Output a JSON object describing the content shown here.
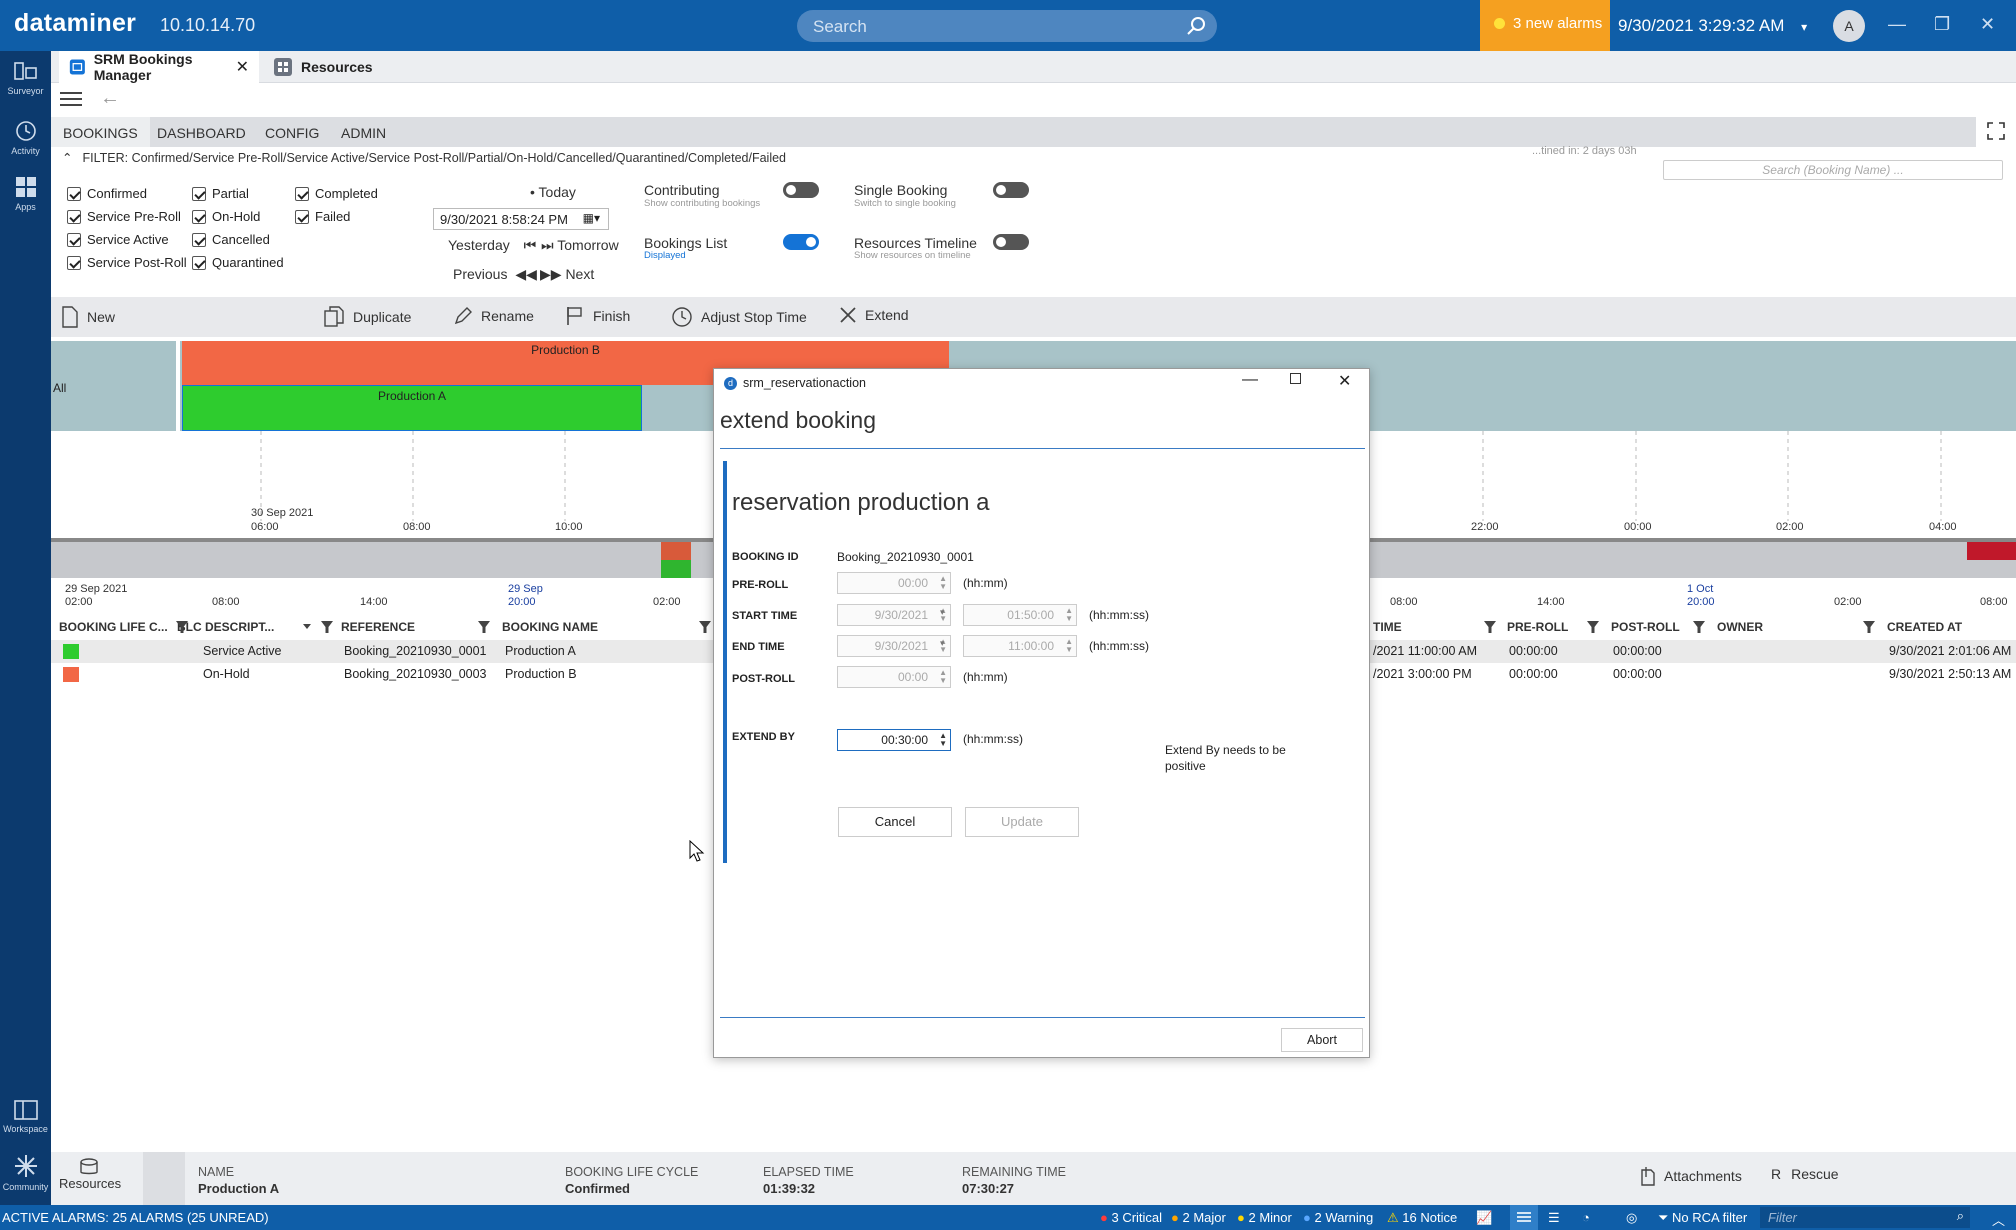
{
  "app": {
    "brand": "dataminer",
    "version": "10.10.14.70",
    "search_placeholder": "Search",
    "alarms": "3 new alarms",
    "datetime": "9/30/2021 3:29:32 AM",
    "user_initial": "A"
  },
  "sidebar": [
    {
      "label": "Surveyor",
      "icon": "surveyor-icon"
    },
    {
      "label": "Activity",
      "icon": "history-icon"
    },
    {
      "label": "Apps",
      "icon": "apps-icon"
    },
    {
      "label": "Workspace",
      "icon": "workspace-icon"
    },
    {
      "label": "Community",
      "icon": "community-icon"
    }
  ],
  "tabs": [
    {
      "label": "SRM Bookings Manager"
    },
    {
      "label": "Resources"
    }
  ],
  "nav": [
    "BOOKINGS",
    "DASHBOARD",
    "CONFIG",
    "ADMIN"
  ],
  "filter": {
    "text": "FILTER: Confirmed/Service Pre-Roll/Service Active/Service Post-Roll/Partial/On-Hold/Cancelled/Quarantined/Completed/Failed",
    "runs": "...tined in: 2 days 03h",
    "search_placeholder": "Search (Booking Name) ...",
    "checks": [
      "Confirmed",
      "Service Pre-Roll",
      "Service Active",
      "Service Post-Roll",
      "Partial",
      "On-Hold",
      "Cancelled",
      "Quarantined",
      "Completed",
      "Failed"
    ]
  },
  "datenav": {
    "today": "Today",
    "date": "9/30/2021 8:58:24 PM",
    "yesterday": "Yesterday",
    "tomorrow": "Tomorrow",
    "previous": "Previous",
    "next": "Next"
  },
  "toggles": [
    {
      "label": "Contributing",
      "sub": "Show contributing bookings",
      "on": false
    },
    {
      "label": "Single Booking",
      "sub": "Switch to single booking",
      "on": false
    },
    {
      "label": "Bookings List",
      "sub": "Displayed",
      "on": true
    },
    {
      "label": "Resources Timeline",
      "sub": "Show resources on timeline",
      "on": false
    }
  ],
  "toolbar": [
    "New",
    "Duplicate",
    "Rename",
    "Finish",
    "Adjust Stop Time",
    "Extend"
  ],
  "timeline": {
    "all": "All",
    "prodB": "Production B",
    "prodA": "Production A",
    "ticks": [
      {
        "date": "30 Sep 2021",
        "time": "06:00"
      },
      {
        "time": "08:00"
      },
      {
        "time": "10:00"
      },
      {
        "time": "22:00"
      },
      {
        "time": "00:00"
      },
      {
        "time": "02:00"
      },
      {
        "time": "04:00"
      }
    ],
    "ov_ticks": [
      {
        "date": "29 Sep 2021",
        "time": "02:00"
      },
      {
        "time": "08:00"
      },
      {
        "time": "14:00"
      },
      {
        "date": "29 Sep",
        "time": "20:00"
      },
      {
        "time": "02:00"
      },
      {
        "time": "08:00"
      },
      {
        "time": "14:00"
      },
      {
        "date": "1 Oct",
        "time": "20:00"
      },
      {
        "time": "02:00"
      },
      {
        "time": "08:00"
      }
    ]
  },
  "table": {
    "headers": [
      "BOOKING LIFE C...",
      "BLC DESCRIPT...",
      "REFERENCE",
      "BOOKING NAME",
      "TIME",
      "PRE-ROLL",
      "POST-ROLL",
      "OWNER",
      "CREATED AT"
    ],
    "rows": [
      {
        "color": "#2ecc2e",
        "blc": "Service Active",
        "ref": "Booking_20210930_0001",
        "name": "Production A",
        "time": "/2021 11:00:00 AM",
        "pre": "00:00:00",
        "post": "00:00:00",
        "created": "9/30/2021 2:01:06 AM"
      },
      {
        "color": "#f26745",
        "blc": "On-Hold",
        "ref": "Booking_20210930_0003",
        "name": "Production B",
        "time": "/2021 3:00:00 PM",
        "pre": "00:00:00",
        "post": "00:00:00",
        "created": "9/30/2021 2:50:13 AM"
      }
    ]
  },
  "dialog": {
    "title": "srm_reservationaction",
    "heading": "extend booking",
    "sub": "reservation production a",
    "booking_id_label": "BOOKING ID",
    "booking_id": "Booking_20210930_0001",
    "preroll_label": "PRE-ROLL",
    "preroll": "00:00",
    "hhmm": "(hh:mm)",
    "hhmmss": "(hh:mm:ss)",
    "start_label": "START TIME",
    "start_date": "9/30/2021",
    "start_time": "01:50:00",
    "end_label": "END TIME",
    "end_date": "9/30/2021",
    "end_time": "11:00:00",
    "postroll_label": "POST-ROLL",
    "postroll": "00:00",
    "extend_label": "EXTEND BY",
    "extend": "00:30:00",
    "hint": "Extend By needs to be positive",
    "cancel": "Cancel",
    "update": "Update",
    "abort": "Abort"
  },
  "bottom": {
    "resources": "Resources",
    "name_label": "NAME",
    "name": "Production A",
    "blc_label": "BOOKING LIFE CYCLE",
    "blc": "Confirmed",
    "elapsed_label": "ELAPSED TIME",
    "elapsed": "01:39:32",
    "remaining_label": "REMAINING TIME",
    "remaining": "07:30:27",
    "attachments": "Attachments",
    "rescue": "Rescue"
  },
  "status": {
    "alarms": "ACTIVE ALARMS: 25 ALARMS (25 UNREAD)",
    "critical": "3 Critical",
    "major": "2 Major",
    "minor": "2 Minor",
    "warning": "2 Warning",
    "notice": "16 Notice",
    "rca": "No RCA filter",
    "filter": "Filter",
    "colors": {
      "critical": "#ff3b3b",
      "major": "#ffa500",
      "minor": "#ffd700",
      "warning": "#5aa7ff"
    }
  }
}
